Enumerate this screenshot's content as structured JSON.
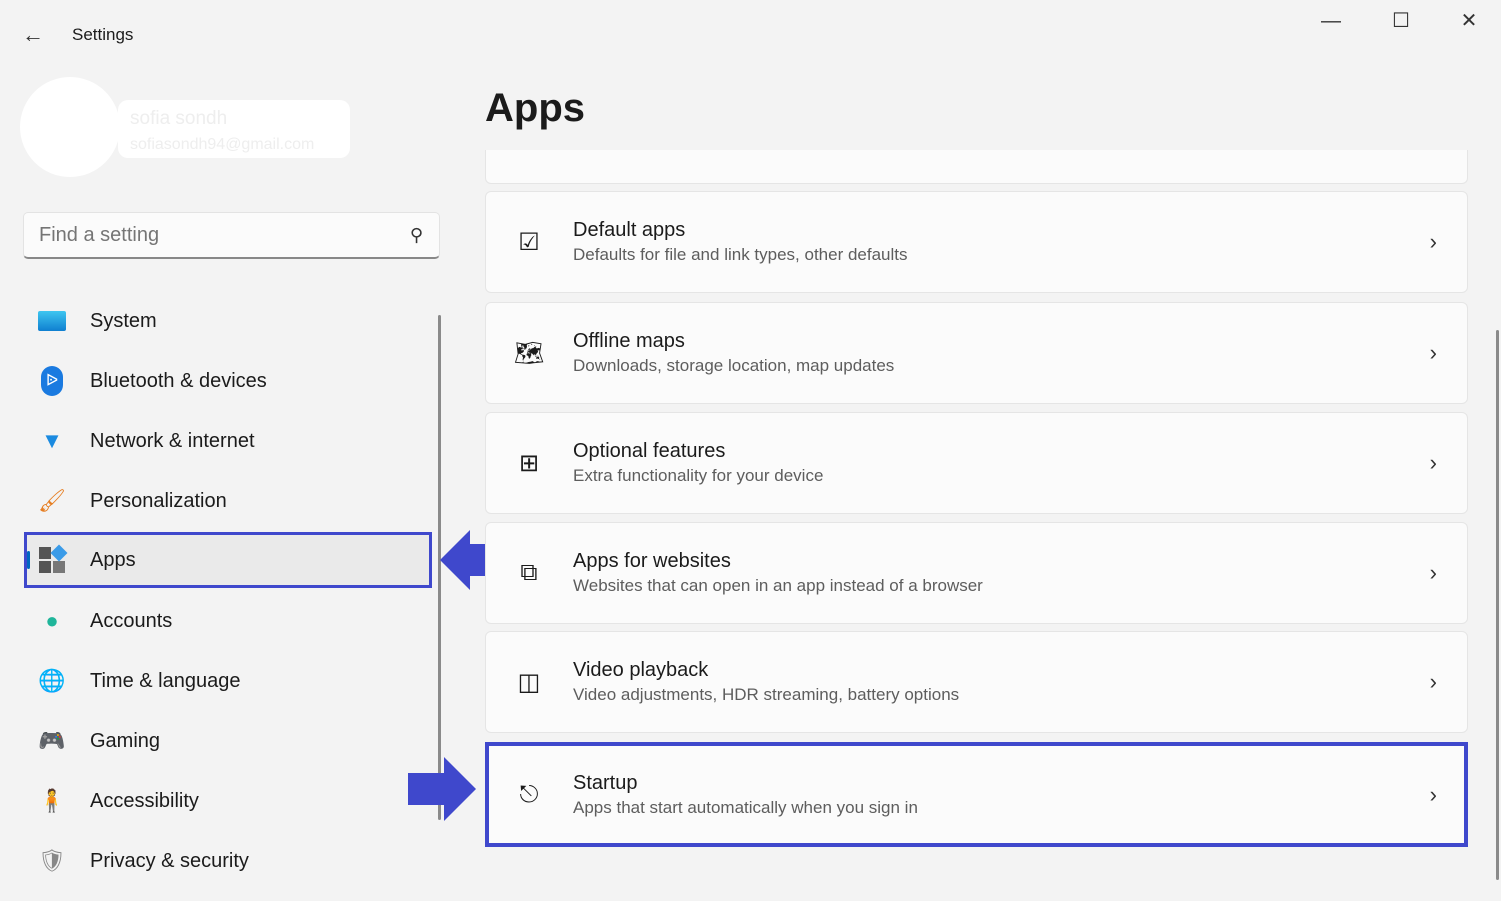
{
  "window": {
    "title": "Settings",
    "back_icon": "arrow-left-icon",
    "controls": [
      "minimize-icon",
      "maximize-icon",
      "close-icon"
    ]
  },
  "user": {
    "name": "sofia sondh",
    "email": "sofiasondh94@gmail.com"
  },
  "search": {
    "placeholder": "Find a setting"
  },
  "sidebar": {
    "items": [
      {
        "label": "System",
        "icon": "monitor-icon"
      },
      {
        "label": "Bluetooth & devices",
        "icon": "bluetooth-icon"
      },
      {
        "label": "Network & internet",
        "icon": "wifi-icon"
      },
      {
        "label": "Personalization",
        "icon": "brush-icon"
      },
      {
        "label": "Apps",
        "icon": "apps-icon",
        "selected": true
      },
      {
        "label": "Accounts",
        "icon": "person-icon"
      },
      {
        "label": "Time & language",
        "icon": "globe-clock-icon"
      },
      {
        "label": "Gaming",
        "icon": "gamepad-icon"
      },
      {
        "label": "Accessibility",
        "icon": "accessibility-icon"
      },
      {
        "label": "Privacy & security",
        "icon": "shield-icon"
      }
    ]
  },
  "main": {
    "title": "Apps",
    "cards": [
      {
        "title": "Default apps",
        "desc": "Defaults for file and link types, other defaults",
        "icon": "default-apps-icon"
      },
      {
        "title": "Offline maps",
        "desc": "Downloads, storage location, map updates",
        "icon": "map-download-icon"
      },
      {
        "title": "Optional features",
        "desc": "Extra functionality for your device",
        "icon": "add-grid-icon"
      },
      {
        "title": "Apps for websites",
        "desc": "Websites that can open in an app instead of a browser",
        "icon": "open-external-icon"
      },
      {
        "title": "Video playback",
        "desc": "Video adjustments, HDR streaming, battery options",
        "icon": "video-camera-icon"
      },
      {
        "title": "Startup",
        "desc": "Apps that start automatically when you sign in",
        "icon": "startup-icon",
        "highlighted": true
      }
    ]
  },
  "annotation_color": "#3f48cc"
}
